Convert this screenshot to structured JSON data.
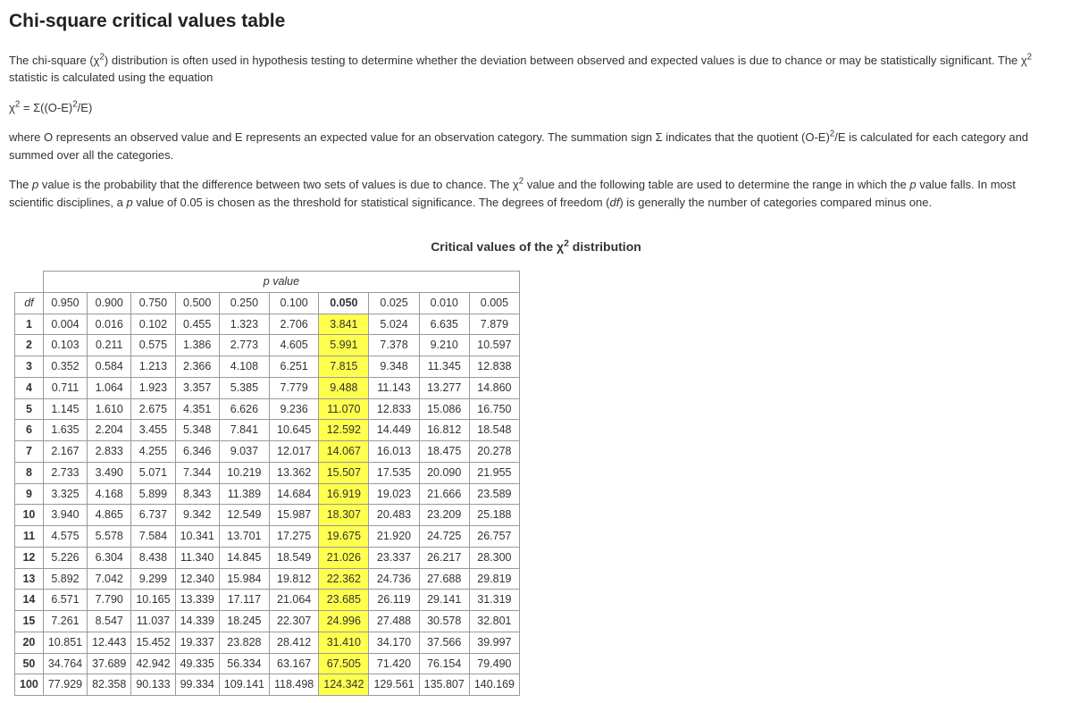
{
  "title": "Chi-square critical values table",
  "intro1_a": "The chi-square (χ",
  "intro1_b": ") distribution is often used in hypothesis testing to determine whether the deviation between observed and expected values is due to chance or may be statistically significant. The χ",
  "intro1_c": " statistic is calculated using the equation",
  "equation_a": "χ",
  "equation_b": " = Σ((O-E)",
  "equation_c": "/E)",
  "intro2_a": "where O represents an observed value and E represents an expected value for an observation category. The summation sign Σ indicates that the quotient (O-E)",
  "intro2_b": "/E is calculated for each category and summed over all the categories.",
  "intro3_a": "The ",
  "intro3_p1": "p",
  "intro3_b": " value is the probability that the difference between two sets of values is due to chance. The χ",
  "intro3_c": " value and the following table are used to determine the range in which the ",
  "intro3_p2": "p",
  "intro3_d": " value falls. In most scientific disciplines, a ",
  "intro3_p3": "p",
  "intro3_e": " value of 0.05 is chosen as the threshold for statistical significance. The degrees of freedom (",
  "intro3_df": "df",
  "intro3_f": ") is generally the number of categories compared minus one.",
  "caption_a": "Critical values of the χ",
  "caption_b": " distribution",
  "pvalue_header": "p",
  "pvalue_header_suffix": " value",
  "df_label": "df",
  "chart_data": {
    "type": "table",
    "p_values": [
      "0.950",
      "0.900",
      "0.750",
      "0.500",
      "0.250",
      "0.100",
      "0.050",
      "0.025",
      "0.010",
      "0.005"
    ],
    "highlight_column_index": 6,
    "rows": [
      {
        "df": "1",
        "v": [
          "0.004",
          "0.016",
          "0.102",
          "0.455",
          "1.323",
          "2.706",
          "3.841",
          "5.024",
          "6.635",
          "7.879"
        ]
      },
      {
        "df": "2",
        "v": [
          "0.103",
          "0.211",
          "0.575",
          "1.386",
          "2.773",
          "4.605",
          "5.991",
          "7.378",
          "9.210",
          "10.597"
        ]
      },
      {
        "df": "3",
        "v": [
          "0.352",
          "0.584",
          "1.213",
          "2.366",
          "4.108",
          "6.251",
          "7.815",
          "9.348",
          "11.345",
          "12.838"
        ]
      },
      {
        "df": "4",
        "v": [
          "0.711",
          "1.064",
          "1.923",
          "3.357",
          "5.385",
          "7.779",
          "9.488",
          "11.143",
          "13.277",
          "14.860"
        ]
      },
      {
        "df": "5",
        "v": [
          "1.145",
          "1.610",
          "2.675",
          "4.351",
          "6.626",
          "9.236",
          "11.070",
          "12.833",
          "15.086",
          "16.750"
        ]
      },
      {
        "df": "6",
        "v": [
          "1.635",
          "2.204",
          "3.455",
          "5.348",
          "7.841",
          "10.645",
          "12.592",
          "14.449",
          "16.812",
          "18.548"
        ]
      },
      {
        "df": "7",
        "v": [
          "2.167",
          "2.833",
          "4.255",
          "6.346",
          "9.037",
          "12.017",
          "14.067",
          "16.013",
          "18.475",
          "20.278"
        ]
      },
      {
        "df": "8",
        "v": [
          "2.733",
          "3.490",
          "5.071",
          "7.344",
          "10.219",
          "13.362",
          "15.507",
          "17.535",
          "20.090",
          "21.955"
        ]
      },
      {
        "df": "9",
        "v": [
          "3.325",
          "4.168",
          "5.899",
          "8.343",
          "11.389",
          "14.684",
          "16.919",
          "19.023",
          "21.666",
          "23.589"
        ]
      },
      {
        "df": "10",
        "v": [
          "3.940",
          "4.865",
          "6.737",
          "9.342",
          "12.549",
          "15.987",
          "18.307",
          "20.483",
          "23.209",
          "25.188"
        ]
      },
      {
        "df": "11",
        "v": [
          "4.575",
          "5.578",
          "7.584",
          "10.341",
          "13.701",
          "17.275",
          "19.675",
          "21.920",
          "24.725",
          "26.757"
        ]
      },
      {
        "df": "12",
        "v": [
          "5.226",
          "6.304",
          "8.438",
          "11.340",
          "14.845",
          "18.549",
          "21.026",
          "23.337",
          "26.217",
          "28.300"
        ]
      },
      {
        "df": "13",
        "v": [
          "5.892",
          "7.042",
          "9.299",
          "12.340",
          "15.984",
          "19.812",
          "22.362",
          "24.736",
          "27.688",
          "29.819"
        ]
      },
      {
        "df": "14",
        "v": [
          "6.571",
          "7.790",
          "10.165",
          "13.339",
          "17.117",
          "21.064",
          "23.685",
          "26.119",
          "29.141",
          "31.319"
        ]
      },
      {
        "df": "15",
        "v": [
          "7.261",
          "8.547",
          "11.037",
          "14.339",
          "18.245",
          "22.307",
          "24.996",
          "27.488",
          "30.578",
          "32.801"
        ]
      },
      {
        "df": "20",
        "v": [
          "10.851",
          "12.443",
          "15.452",
          "19.337",
          "23.828",
          "28.412",
          "31.410",
          "34.170",
          "37.566",
          "39.997"
        ]
      },
      {
        "df": "50",
        "v": [
          "34.764",
          "37.689",
          "42.942",
          "49.335",
          "56.334",
          "63.167",
          "67.505",
          "71.420",
          "76.154",
          "79.490"
        ]
      },
      {
        "df": "100",
        "v": [
          "77.929",
          "82.358",
          "90.133",
          "99.334",
          "109.141",
          "118.498",
          "124.342",
          "129.561",
          "135.807",
          "140.169"
        ]
      }
    ]
  }
}
